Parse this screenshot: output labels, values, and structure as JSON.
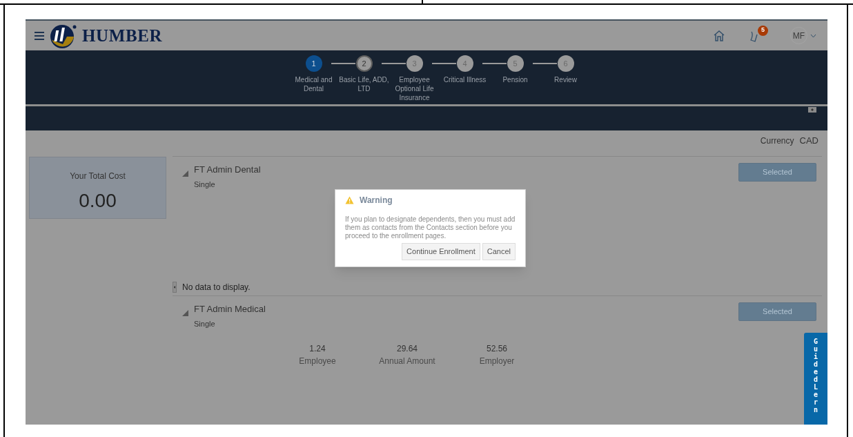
{
  "header": {
    "brand": "HUMBER",
    "notification_count": "5",
    "user_initials": "MF"
  },
  "train": [
    {
      "number": "1",
      "label": "Medical and Dental",
      "selected": true,
      "visited": true
    },
    {
      "number": "2",
      "label": "Basic Life, ADD, LTD",
      "selected": false,
      "visited": true
    },
    {
      "number": "3",
      "label": "Employee Optional Life Insurance",
      "selected": false,
      "visited": false
    },
    {
      "number": "4",
      "label": "Critical Illness",
      "selected": false,
      "visited": false
    },
    {
      "number": "5",
      "label": "Pension",
      "selected": false,
      "visited": false
    },
    {
      "number": "6",
      "label": "Review",
      "selected": false,
      "visited": false
    }
  ],
  "currency": {
    "label": "Currency",
    "value": "CAD"
  },
  "total_cost": {
    "label": "Your Total Cost",
    "value": "0.00"
  },
  "plans": [
    {
      "name": "FT Admin Dental",
      "option": "Single",
      "button": "Selected",
      "empty_text": "No data to display."
    },
    {
      "name": "FT Admin Medical",
      "option": "Single",
      "button": "Selected",
      "amounts": [
        {
          "value": "1.24",
          "label": "Employee"
        },
        {
          "value": "29.64",
          "label": "Annual Amount"
        },
        {
          "value": "52.56",
          "label": "Employer"
        }
      ]
    }
  ],
  "dialog": {
    "title": "Warning",
    "message": "If you plan to designate dependents, then you must add them as contacts from the Contacts section before you proceed to the enrollment pages.",
    "buttons": [
      "Continue Enrollment",
      "Cancel"
    ]
  },
  "guided_learning_tab": "Guided Lern"
}
